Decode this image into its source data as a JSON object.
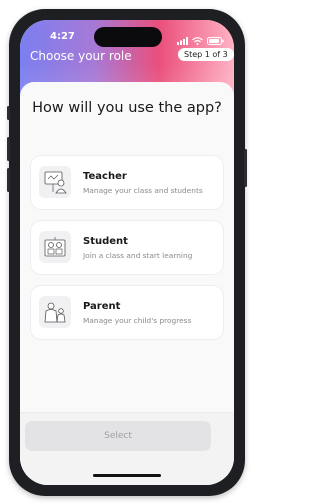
{
  "status": {
    "time": "4:27"
  },
  "header": {
    "title": "Choose your role",
    "step": "Step 1 of 3"
  },
  "main": {
    "question": "How will you use the app?",
    "roles": [
      {
        "title": "Teacher",
        "description": "Manage your class and students",
        "icon": "teacher-icon"
      },
      {
        "title": "Student",
        "description": "Join a class and start learning",
        "icon": "student-icon"
      },
      {
        "title": "Parent",
        "description": "Manage your child's progress",
        "icon": "parent-icon"
      }
    ]
  },
  "footer": {
    "select_label": "Select"
  },
  "colors": {
    "gradient": [
      "#7b7ff0",
      "#ea4f7b",
      "#ffb2c4"
    ],
    "disabled_button": "#e3e3e5"
  }
}
